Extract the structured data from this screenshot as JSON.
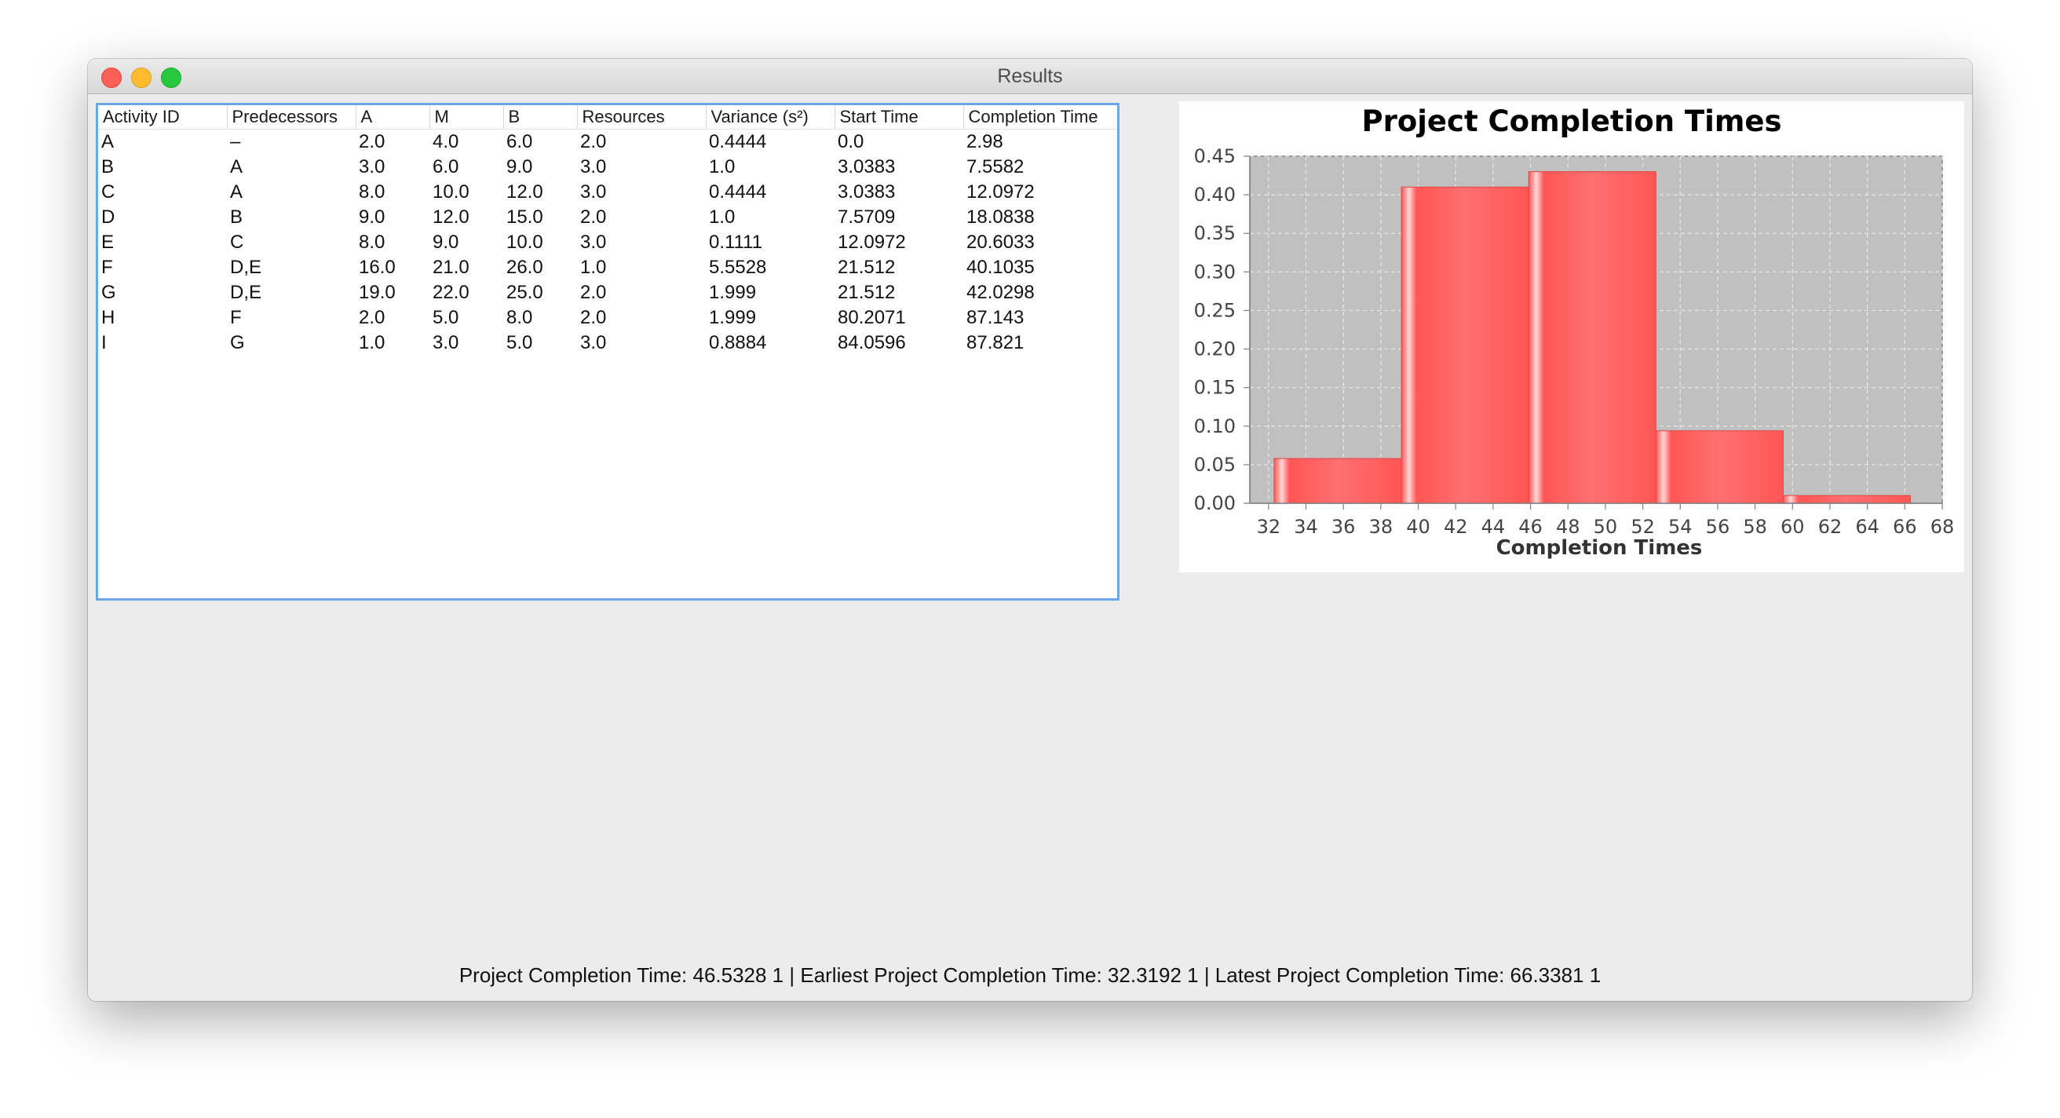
{
  "window": {
    "title": "Results"
  },
  "table": {
    "columns": [
      "Activity ID",
      "Predecessors",
      "A",
      "M",
      "B",
      "Resources",
      "Variance (s²)",
      "Start Time",
      "Completion Time"
    ],
    "rows": [
      [
        "A",
        "–",
        "2.0",
        "4.0",
        "6.0",
        "2.0",
        "0.4444",
        "0.0",
        "2.98"
      ],
      [
        "B",
        "A",
        "3.0",
        "6.0",
        "9.0",
        "3.0",
        "1.0",
        "3.0383",
        "7.5582"
      ],
      [
        "C",
        "A",
        "8.0",
        "10.0",
        "12.0",
        "3.0",
        "0.4444",
        "3.0383",
        "12.0972"
      ],
      [
        "D",
        "B",
        "9.0",
        "12.0",
        "15.0",
        "2.0",
        "1.0",
        "7.5709",
        "18.0838"
      ],
      [
        "E",
        "C",
        "8.0",
        "9.0",
        "10.0",
        "3.0",
        "0.1111",
        "12.0972",
        "20.6033"
      ],
      [
        "F",
        "D,E",
        "16.0",
        "21.0",
        "26.0",
        "1.0",
        "5.5528",
        "21.512",
        "40.1035"
      ],
      [
        "G",
        "D,E",
        "19.0",
        "22.0",
        "25.0",
        "2.0",
        "1.999",
        "21.512",
        "42.0298"
      ],
      [
        "H",
        "F",
        "2.0",
        "5.0",
        "8.0",
        "2.0",
        "1.999",
        "80.2071",
        "87.143"
      ],
      [
        "I",
        "G",
        "1.0",
        "3.0",
        "5.0",
        "3.0",
        "0.8884",
        "84.0596",
        "87.821"
      ]
    ]
  },
  "chart_data": {
    "type": "bar",
    "title": "Project Completion Times",
    "xlabel": "Completion Times",
    "ylabel": "",
    "bins": [
      {
        "start": 32.3,
        "end": 39.1,
        "value": 0.058
      },
      {
        "start": 39.1,
        "end": 45.9,
        "value": 0.41
      },
      {
        "start": 45.9,
        "end": 52.7,
        "value": 0.43
      },
      {
        "start": 52.7,
        "end": 59.5,
        "value": 0.094
      },
      {
        "start": 59.5,
        "end": 66.3,
        "value": 0.01
      }
    ],
    "xlim": [
      31,
      68
    ],
    "ylim": [
      0,
      0.45
    ],
    "xticks": [
      "32",
      "34",
      "36",
      "38",
      "40",
      "42",
      "44",
      "46",
      "48",
      "50",
      "52",
      "54",
      "56",
      "58",
      "60",
      "62",
      "64",
      "66",
      "68"
    ],
    "yticks": [
      "0.00",
      "0.05",
      "0.10",
      "0.15",
      "0.20",
      "0.25",
      "0.30",
      "0.35",
      "0.40",
      "0.45"
    ],
    "grid": true,
    "colors": {
      "bar": "#ff5555",
      "bar_highlight": "#ffffff",
      "plot_background": "#c0c0c0",
      "grid": "#e8e8e8"
    }
  },
  "status": {
    "text": "Project Completion Time: 46.5328 1 | Earliest Project Completion Time: 32.3192 1 | Latest Project Completion Time: 66.3381 1"
  }
}
